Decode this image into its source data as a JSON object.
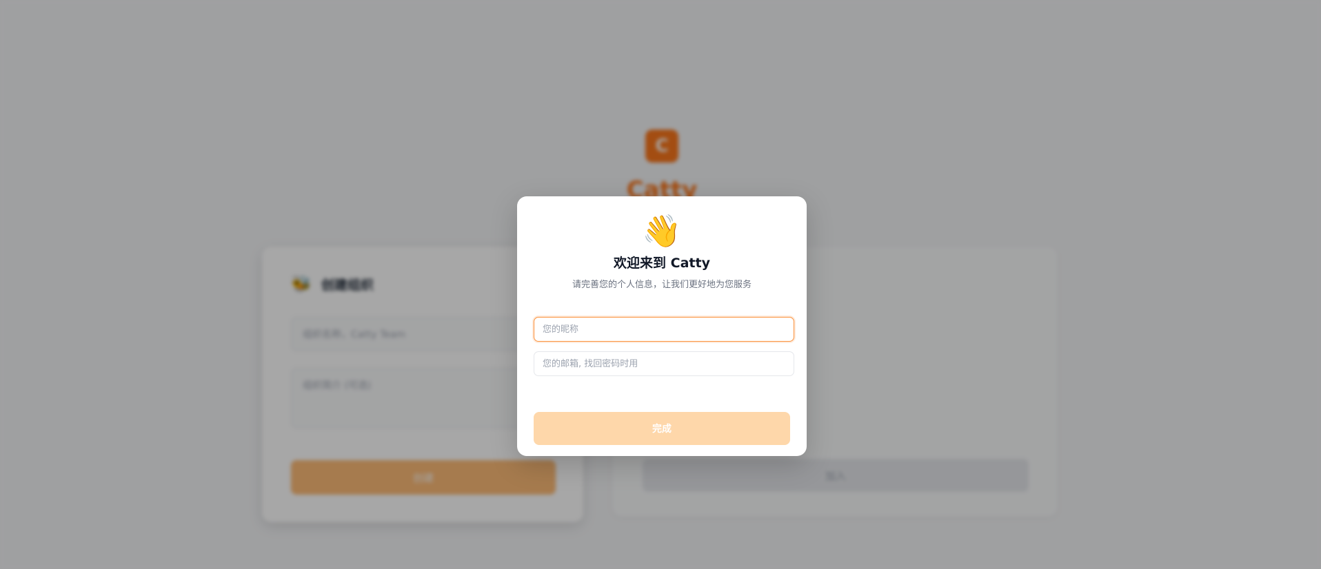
{
  "background": {
    "logo_letter": "C",
    "brand_name": "Catty",
    "create_org_card": {
      "icon": "🐝",
      "title": "创建组织",
      "name_placeholder": "组织名称，Catty Team",
      "desc_placeholder": "组织简介 (可选)",
      "submit_label": "创建"
    },
    "right_card": {
      "button_label": "加入"
    }
  },
  "modal": {
    "icon": "👋",
    "title": "欢迎来到 Catty",
    "subtitle": "请完善您的个人信息，让我们更好地为您服务",
    "nickname_placeholder": "您的昵称",
    "nickname_value": "",
    "email_placeholder": "您的邮箱, 找回密码时用",
    "email_value": "",
    "finish_label": "完成"
  },
  "colors": {
    "accent": "#f97316",
    "accent_disabled": "#fed7aa",
    "focus_border": "#fb923c"
  }
}
